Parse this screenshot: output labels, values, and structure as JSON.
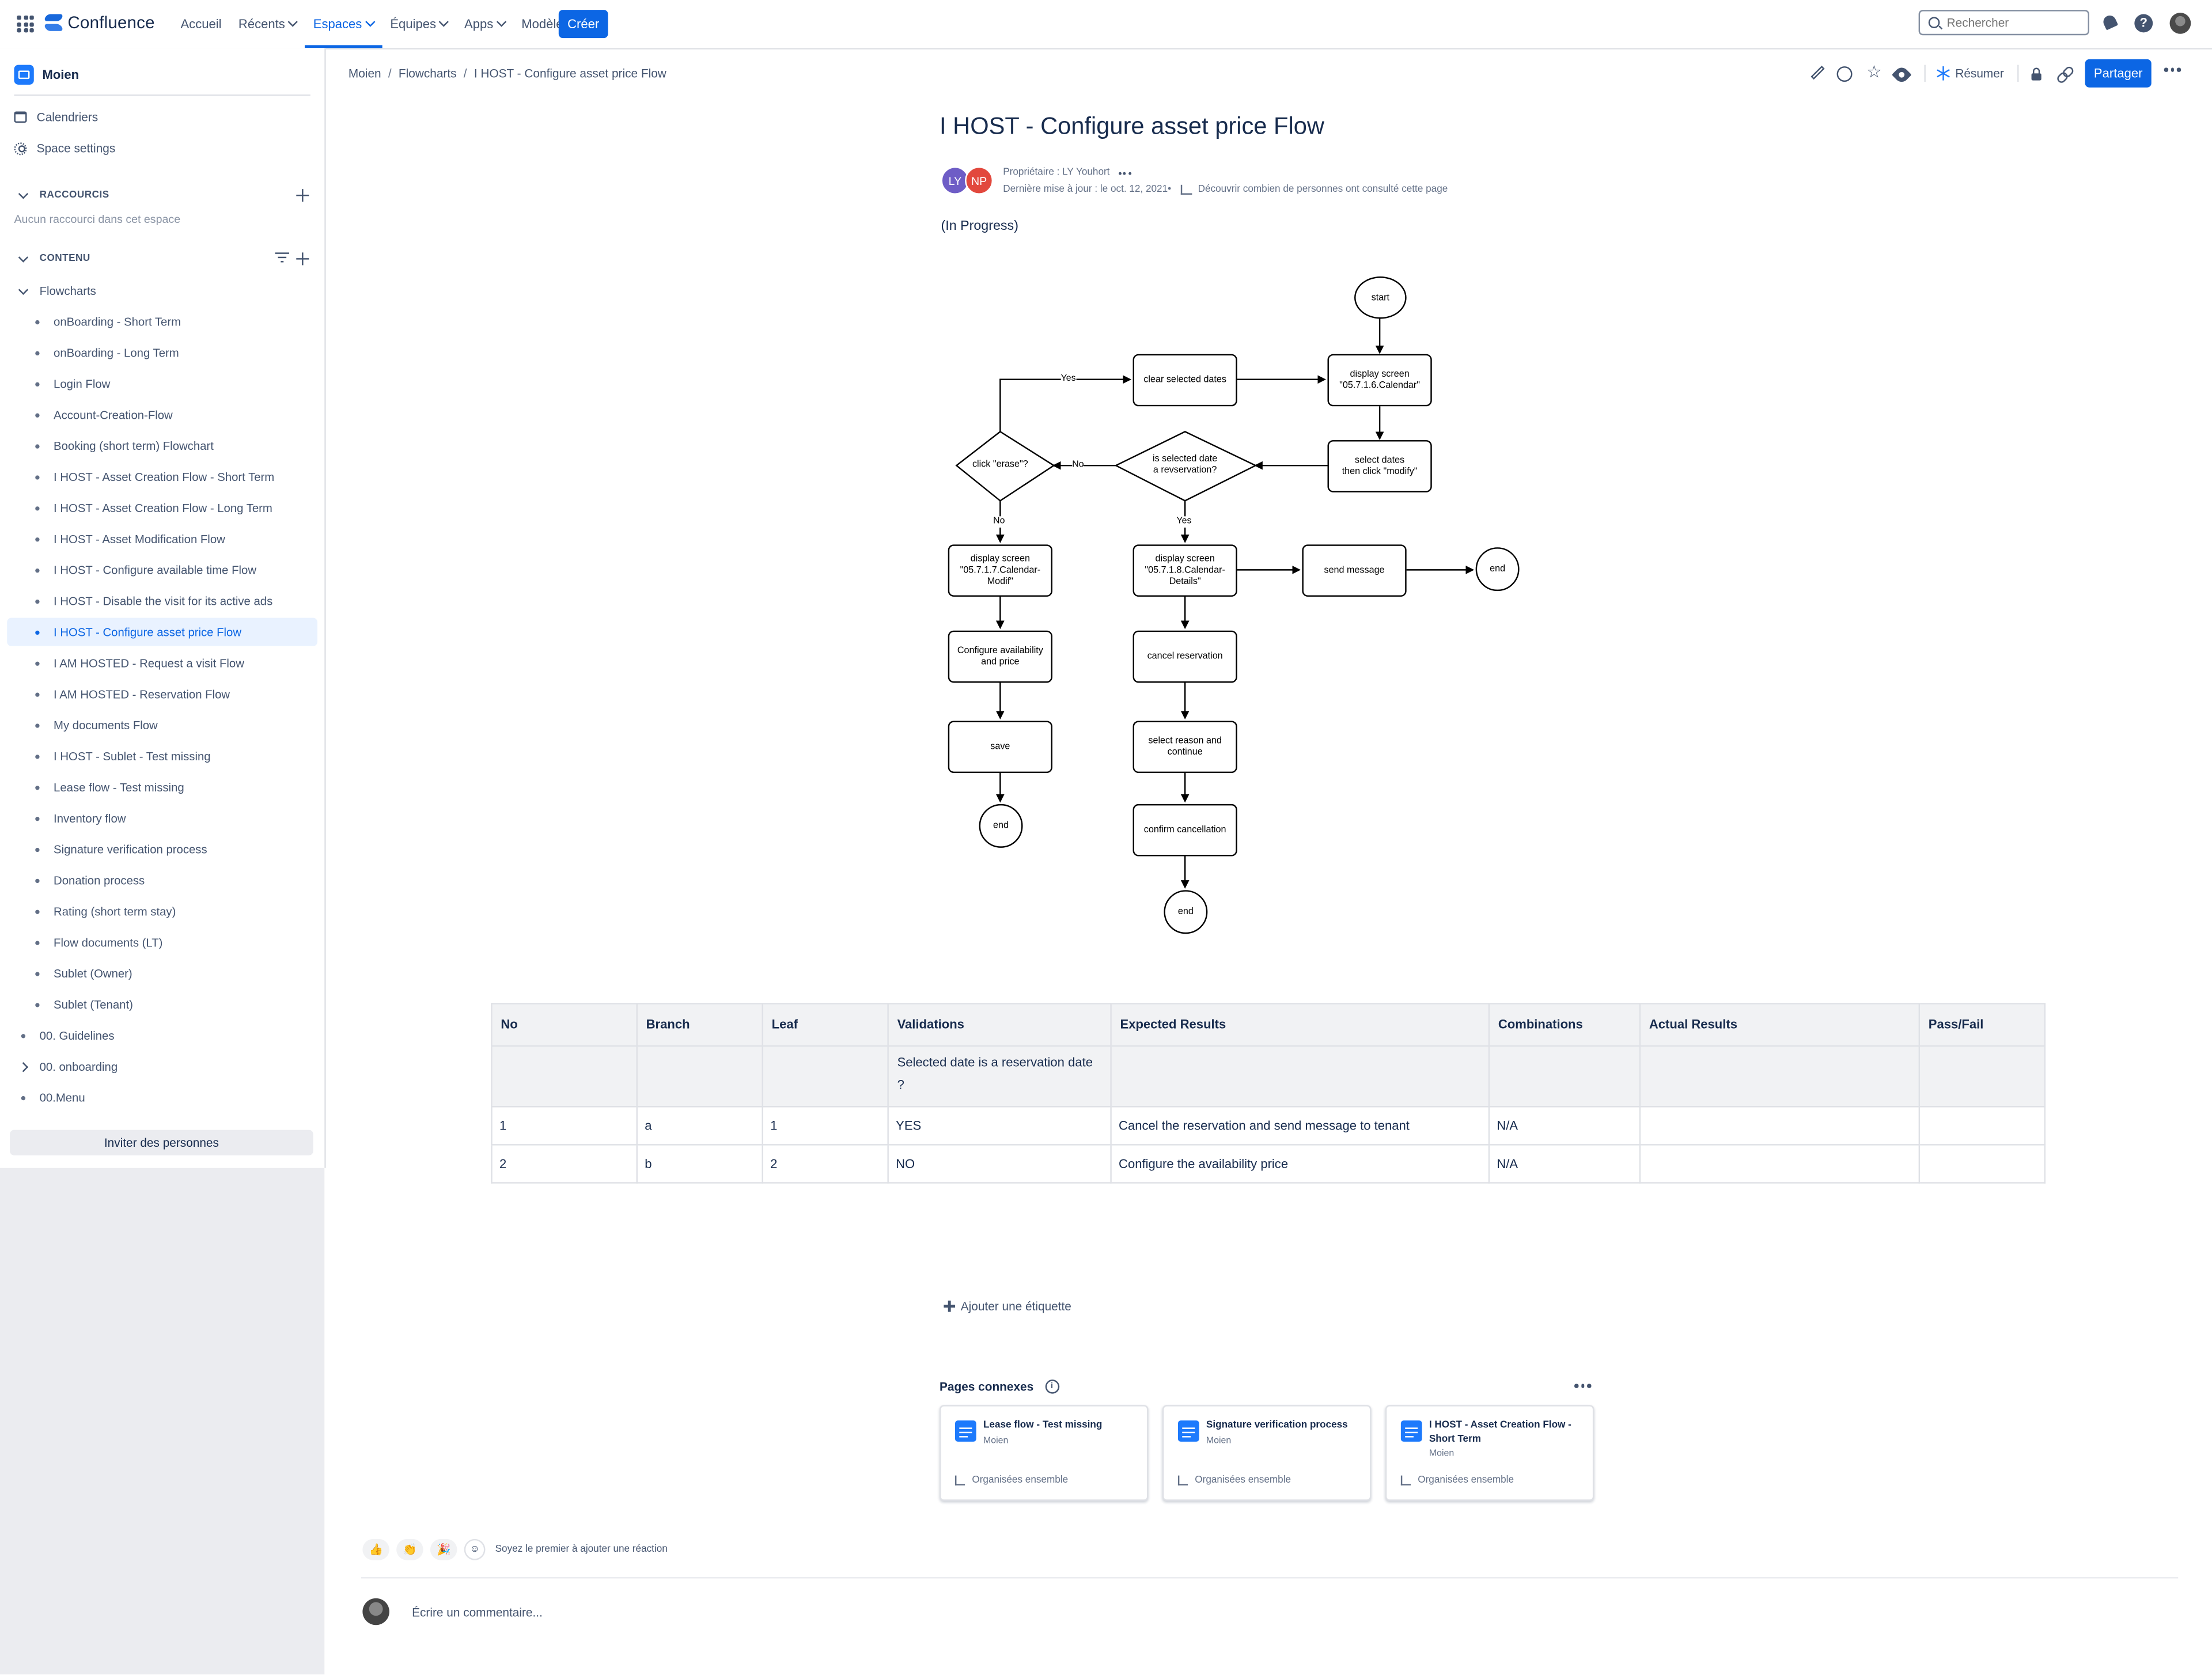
{
  "topnav": {
    "app_name": "Confluence",
    "items": [
      {
        "label": "Accueil",
        "dropdown": false,
        "active": false
      },
      {
        "label": "Récents",
        "dropdown": true,
        "active": false
      },
      {
        "label": "Espaces",
        "dropdown": true,
        "active": true
      },
      {
        "label": "Équipes",
        "dropdown": true,
        "active": false
      },
      {
        "label": "Apps",
        "dropdown": true,
        "active": false
      },
      {
        "label": "Modèles",
        "dropdown": false,
        "active": false
      }
    ],
    "create_label": "Créer",
    "search_placeholder": "Rechercher",
    "icons": [
      "app-switcher-icon",
      "bell-icon",
      "help-icon",
      "avatar"
    ]
  },
  "sidebar": {
    "space_name": "Moien",
    "links": [
      {
        "label": "Calendriers",
        "icon": "calendar-icon"
      },
      {
        "label": "Space settings",
        "icon": "gear-icon"
      }
    ],
    "shortcuts_title": "RACCOURCIS",
    "shortcuts_empty": "Aucun raccourci dans cet espace",
    "content_title": "CONTENU",
    "tree": [
      {
        "label": "Flowcharts",
        "marker": "chevron-down",
        "indent": 0
      },
      {
        "label": "onBoarding - Short Term",
        "marker": "bullet",
        "indent": 1
      },
      {
        "label": "onBoarding - Long Term",
        "marker": "bullet",
        "indent": 1
      },
      {
        "label": "Login Flow",
        "marker": "bullet",
        "indent": 1
      },
      {
        "label": "Account-Creation-Flow",
        "marker": "bullet",
        "indent": 1
      },
      {
        "label": "Booking (short term) Flowchart",
        "marker": "bullet",
        "indent": 1
      },
      {
        "label": "I HOST - Asset Creation Flow - Short Term",
        "marker": "bullet",
        "indent": 1
      },
      {
        "label": "I HOST - Asset Creation Flow - Long Term",
        "marker": "bullet",
        "indent": 1
      },
      {
        "label": "I HOST - Asset Modification Flow",
        "marker": "bullet",
        "indent": 1
      },
      {
        "label": "I HOST - Configure available time Flow",
        "marker": "bullet",
        "indent": 1
      },
      {
        "label": "I HOST - Disable the visit for its active ads",
        "marker": "bullet",
        "indent": 1
      },
      {
        "label": "I HOST - Configure asset price Flow",
        "marker": "bullet",
        "indent": 1,
        "selected": true
      },
      {
        "label": "I AM HOSTED - Request a visit Flow",
        "marker": "bullet",
        "indent": 1
      },
      {
        "label": "I AM HOSTED - Reservation Flow",
        "marker": "bullet",
        "indent": 1
      },
      {
        "label": "My documents Flow",
        "marker": "bullet",
        "indent": 1
      },
      {
        "label": "I HOST - Sublet - Test missing",
        "marker": "bullet",
        "indent": 1
      },
      {
        "label": "Lease flow - Test missing",
        "marker": "bullet",
        "indent": 1
      },
      {
        "label": "Inventory flow",
        "marker": "bullet",
        "indent": 1
      },
      {
        "label": "Signature verification process",
        "marker": "bullet",
        "indent": 1
      },
      {
        "label": "Donation process",
        "marker": "bullet",
        "indent": 1
      },
      {
        "label": "Rating (short term stay)",
        "marker": "bullet",
        "indent": 1
      },
      {
        "label": "Flow documents (LT)",
        "marker": "bullet",
        "indent": 1
      },
      {
        "label": "Sublet (Owner)",
        "marker": "bullet",
        "indent": 1
      },
      {
        "label": "Sublet (Tenant)",
        "marker": "bullet",
        "indent": 1
      },
      {
        "label": "00. Guidelines",
        "marker": "bullet",
        "indent": 0
      },
      {
        "label": "00. onboarding",
        "marker": "chevron-right",
        "indent": 0
      },
      {
        "label": "00.Menu",
        "marker": "bullet",
        "indent": 0
      }
    ],
    "invite_label": "Inviter des personnes"
  },
  "breadcrumb": [
    "Moien",
    "Flowcharts",
    "I HOST - Configure asset price Flow"
  ],
  "toolbar": {
    "summarize_label": "Résumer",
    "share_label": "Partager",
    "icons": [
      "edit-icon",
      "comment-icon",
      "star-icon",
      "watch-icon",
      "restrictions-icon",
      "link-icon",
      "more-icon"
    ]
  },
  "page": {
    "title": "I HOST - Configure asset price Flow",
    "avatars": [
      "LY",
      "NP"
    ],
    "owner_line": "Propriétaire : LY Youhort",
    "updated_line": "Dernière mise à jour : le oct. 12, 2021•",
    "analytics_line": "Découvrir combien de personnes ont consulté cette page",
    "status": "(In Progress)"
  },
  "flowchart": {
    "start": "start",
    "clear_selected": "clear selected dates",
    "display_calendar": "display screen\n\"05.7.1.6.Calendar\"",
    "select_dates": "select dates\nthen click \"modify\"",
    "is_reservation": "is selected date\na revservation?",
    "click_erase": "click \"erase\"?",
    "yes_top": "Yes",
    "no_mid": "No",
    "no_left": "No",
    "yes_mid": "Yes",
    "display_modif": "display screen\n\"05.7.1.7.Calendar-\nModif\"",
    "display_details": "display screen\n\"05.7.1.8.Calendar-\nDetails\"",
    "send_message": "send message",
    "end_right": "end",
    "configure": "Configure availability\nand price",
    "cancel_reservation": "cancel reservation",
    "save": "save",
    "select_reason": "select reason and\ncontinue",
    "end_left": "end",
    "confirm_cancel": "confirm cancellation",
    "end_bottom": "end"
  },
  "table": {
    "headers": [
      "No",
      "Branch",
      "Leaf",
      "Validations",
      "Expected Results",
      "Combinations",
      "Actual Results",
      "Pass/Fail"
    ],
    "sub_header": [
      "",
      "",
      "",
      "Selected date is a reservation date ?",
      "",
      "",
      "",
      ""
    ],
    "rows": [
      [
        "1",
        "a",
        "1",
        "YES",
        "Cancel the reservation and send message to tenant",
        "N/A",
        "",
        ""
      ],
      [
        "2",
        "b",
        "2",
        "NO",
        "Configure the availability price",
        "N/A",
        "",
        ""
      ]
    ]
  },
  "add_label": "Ajouter une étiquette",
  "related": {
    "title": "Pages connexes",
    "cards": [
      {
        "title": "Lease flow - Test missing",
        "space": "Moien",
        "footer": "Organisées ensemble"
      },
      {
        "title": "Signature verification process",
        "space": "Moien",
        "footer": "Organisées ensemble"
      },
      {
        "title": "I HOST - Asset Creation Flow - Short Term",
        "space": "Moien",
        "footer": "Organisées ensemble"
      }
    ]
  },
  "reactions": {
    "emojis": [
      "👍",
      "👏",
      "🎉"
    ],
    "prompt": "Soyez le premier à ajouter une réaction"
  },
  "comment_placeholder": "Écrire un commentaire..."
}
